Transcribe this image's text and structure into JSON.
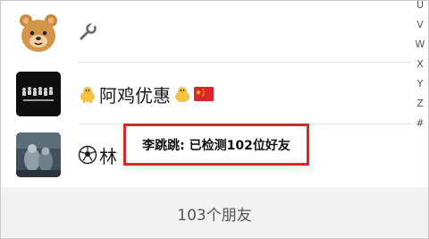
{
  "contacts": [
    {
      "avatar_icon": "bear-avatar",
      "label_icon": "wrench-icon",
      "name": ""
    },
    {
      "avatar_icon": "group-photo-avatar",
      "label_icon": "chick-icon",
      "name": "阿鸡优惠",
      "suffix_icons": [
        "chick-icon",
        "china-flag-icon"
      ]
    },
    {
      "avatar_icon": "photo-avatar",
      "label_icon": "soccer-ball-icon",
      "name": "林"
    }
  ],
  "index_letters": [
    "U",
    "V",
    "W",
    "X",
    "Y",
    "Z",
    "#"
  ],
  "footer": {
    "friend_count": "103个朋友"
  },
  "toast": {
    "text": "李跳跳: 已检测102位好友"
  },
  "colors": {
    "highlight_border": "#d42a2a",
    "footer_bg": "#f2f2f2"
  }
}
